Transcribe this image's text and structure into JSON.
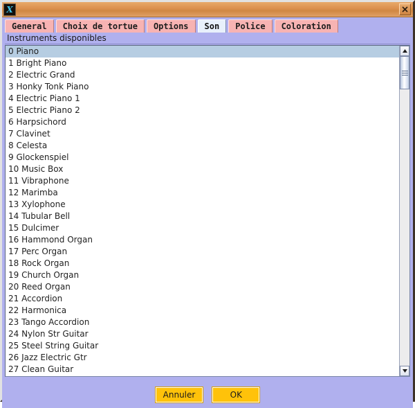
{
  "window": {
    "title": "",
    "icon": "turtle-app-icon",
    "close_label": "×",
    "close_icon": "close-icon"
  },
  "tabs": [
    {
      "label": "General",
      "selected": false
    },
    {
      "label": "Choix de tortue",
      "selected": false
    },
    {
      "label": "Options",
      "selected": false
    },
    {
      "label": "Son",
      "selected": true
    },
    {
      "label": "Police",
      "selected": false
    },
    {
      "label": "Coloration",
      "selected": false
    }
  ],
  "content": {
    "section_label": "Instruments disponibles",
    "selected_index": 0,
    "instruments": [
      "0 Piano",
      "1 Bright Piano",
      "2 Electric Grand",
      "3 Honky Tonk Piano",
      "4 Electric Piano 1",
      "5 Electric Piano 2",
      "6 Harpsichord",
      "7 Clavinet",
      "8 Celesta",
      "9 Glockenspiel",
      "10 Music Box",
      "11 Vibraphone",
      "12 Marimba",
      "13 Xylophone",
      "14 Tubular Bell",
      "15 Dulcimer",
      "16 Hammond Organ",
      "17 Perc Organ",
      "18 Rock Organ",
      "19 Church Organ",
      "20 Reed Organ",
      "21 Accordion",
      "22 Harmonica",
      "23 Tango Accordion",
      "24 Nylon Str Guitar",
      "25 Steel String Guitar",
      "26 Jazz Electric Gtr",
      "27 Clean Guitar"
    ]
  },
  "scrollbar": {
    "up_icon": "triangle-up-icon",
    "down_icon": "triangle-down-icon",
    "thumb_icon": "scrollbar-grip-icon"
  },
  "footer": {
    "cancel_label": "Annuler",
    "ok_label": "OK"
  },
  "colors": {
    "titlebar": "#dd9250",
    "panel": "#b0b0ee",
    "tab": "#f7b3b3",
    "tab_selected": "#e8f0fb",
    "selection": "#b6cde2",
    "button": "#ffc20a"
  }
}
